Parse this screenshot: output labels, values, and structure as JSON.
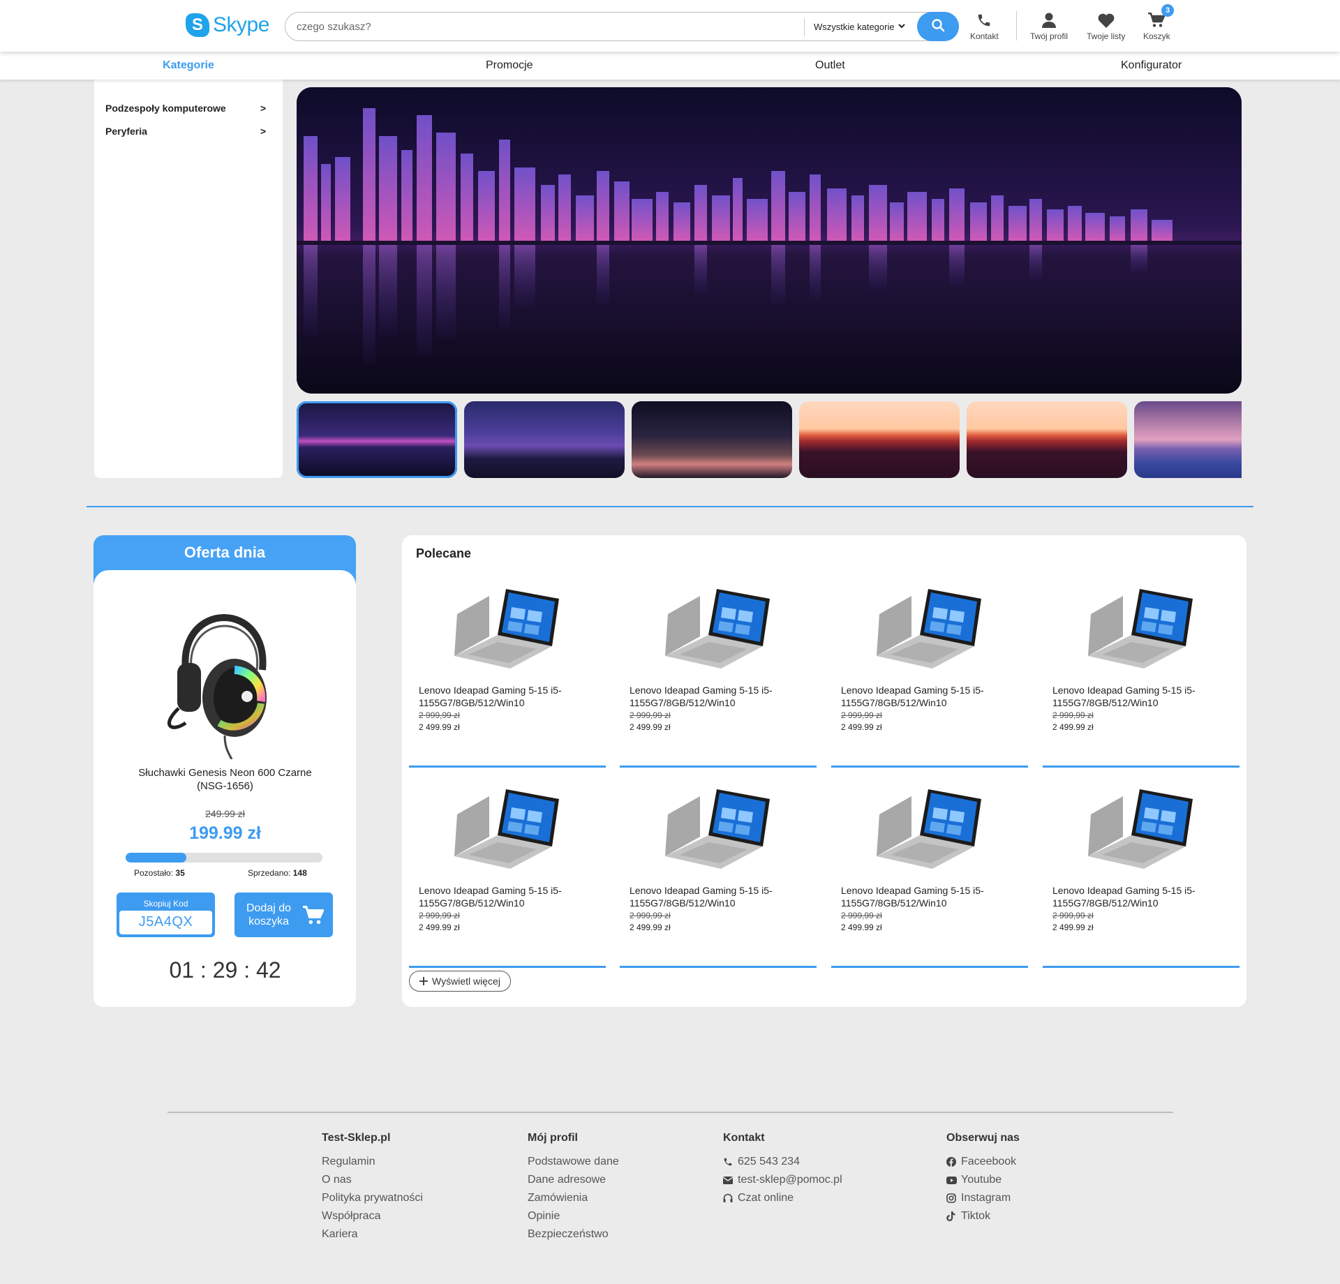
{
  "header": {
    "logo_text": "Skype",
    "logo_letter": "S",
    "search_placeholder": "czego szukasz?",
    "category_select": "Wszystkie kategorie",
    "contact_label": "Kontakt",
    "profile_label": "Twój profil",
    "lists_label": "Twoje listy",
    "cart_label": "Koszyk",
    "cart_count": "3"
  },
  "nav": {
    "categories": "Kategorie",
    "promotions": "Promocje",
    "outlet": "Outlet",
    "configurator": "Konfigurator"
  },
  "sidebar": {
    "items": [
      {
        "label": "Podzespoły komputerowe",
        "arrow": ">"
      },
      {
        "label": "Peryferia",
        "arrow": ">"
      }
    ]
  },
  "deal": {
    "title": "Oferta dnia",
    "product_name": "Słuchawki Genesis Neon 600 Czarne (NSG-1656)",
    "old_price": "249.99 zł",
    "new_price": "199.99 zł",
    "sold_fraction": 0.31,
    "remaining_label": "Pozostało:",
    "remaining_value": "35",
    "sold_label": "Sprzedano:",
    "sold_value": "148",
    "copy_code_label": "Skopiuj Kod",
    "code": "J5A4QX",
    "add_to_cart": "Dodaj do koszyka",
    "timer": "01 : 29 : 42"
  },
  "recommended": {
    "title": "Polecane",
    "products": [
      {
        "name": "Lenovo Ideapad Gaming 5-15 i5-1155G7/8GB/512/Win10",
        "old_price": "2 999,99 zł",
        "new_price": "2 499.99 zł"
      },
      {
        "name": "Lenovo Ideapad Gaming 5-15 i5-1155G7/8GB/512/Win10",
        "old_price": "2 999,99 zł",
        "new_price": "2 499.99 zł"
      },
      {
        "name": "Lenovo Ideapad Gaming 5-15 i5-1155G7/8GB/512/Win10",
        "old_price": "2 999,99 zł",
        "new_price": "2 499.99 zł"
      },
      {
        "name": "Lenovo Ideapad Gaming 5-15 i5-1155G7/8GB/512/Win10",
        "old_price": "2 999,99 zł",
        "new_price": "2 499.99 zł"
      },
      {
        "name": "Lenovo Ideapad Gaming 5-15 i5-1155G7/8GB/512/Win10",
        "old_price": "2 999,99 zł",
        "new_price": "2 499.99 zł"
      },
      {
        "name": "Lenovo Ideapad Gaming 5-15 i5-1155G7/8GB/512/Win10",
        "old_price": "2 999,99 zł",
        "new_price": "2 499.99 zł"
      },
      {
        "name": "Lenovo Ideapad Gaming 5-15 i5-1155G7/8GB/512/Win10",
        "old_price": "2 999,99 zł",
        "new_price": "2 499.99 zł"
      },
      {
        "name": "Lenovo Ideapad Gaming 5-15 i5-1155G7/8GB/512/Win10",
        "old_price": "2 999,99 zł",
        "new_price": "2 499.99 zł"
      }
    ],
    "more_label": "Wyświetl więcej"
  },
  "footer": {
    "col1": {
      "title": "Test-Sklep.pl",
      "links": [
        "Regulamin",
        "O nas",
        "Polityka prywatności",
        "Współpraca",
        "Kariera"
      ]
    },
    "col2": {
      "title": "Mój profil",
      "links": [
        "Podstawowe dane",
        "Dane adresowe",
        "Zamówienia",
        "Opinie",
        "Bezpieczeństwo"
      ]
    },
    "col3": {
      "title": "Kontakt",
      "phone": "625 543 234",
      "email": "test-sklep@pomoc.pl",
      "chat": "Czat online"
    },
    "col4": {
      "title": "Obserwuj nas",
      "facebook": "Faceebook",
      "youtube": "Youtube",
      "instagram": "Instagram",
      "tiktok": "Tiktok"
    }
  },
  "colors": {
    "accent": "#3d9bf0",
    "logo": "#1fa3ea",
    "background": "#ebebeb"
  }
}
